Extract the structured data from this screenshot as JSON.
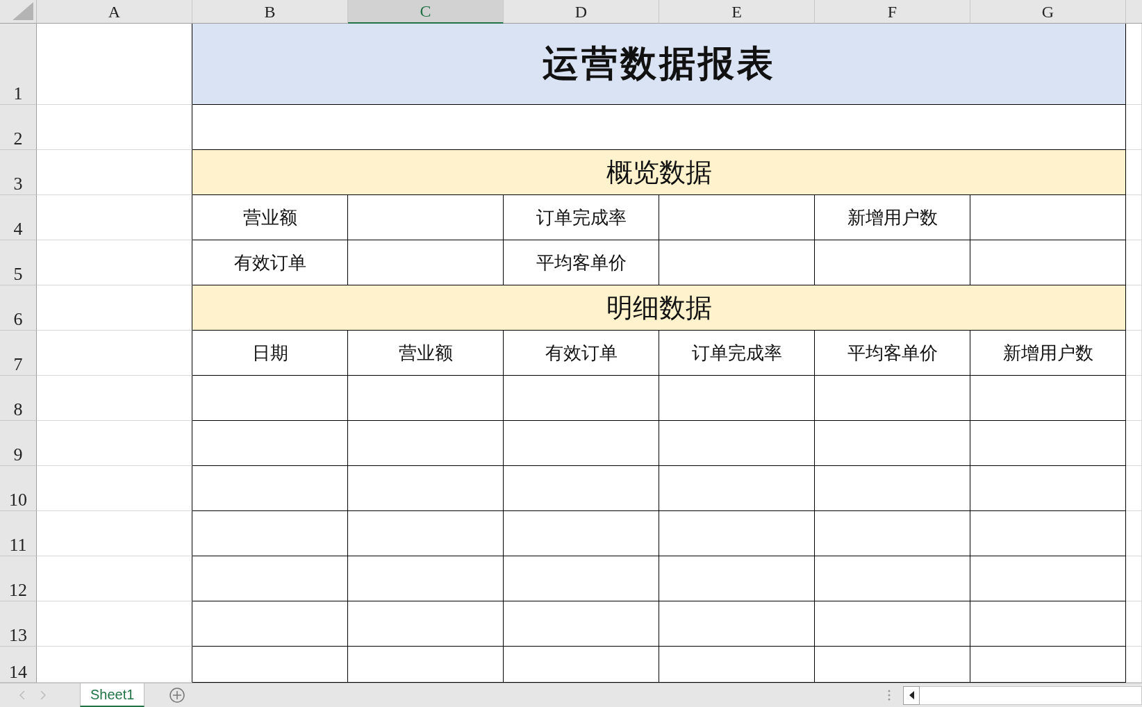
{
  "columns": [
    {
      "label": "A",
      "selected": false
    },
    {
      "label": "B",
      "selected": false
    },
    {
      "label": "C",
      "selected": true
    },
    {
      "label": "D",
      "selected": false
    },
    {
      "label": "E",
      "selected": false
    },
    {
      "label": "F",
      "selected": false
    },
    {
      "label": "G",
      "selected": false
    }
  ],
  "rows": [
    {
      "number": "1",
      "kind": "title",
      "text": "运营数据报表"
    },
    {
      "number": "2",
      "kind": "blank"
    },
    {
      "number": "3",
      "kind": "section",
      "text": "概览数据"
    },
    {
      "number": "4",
      "kind": "cells",
      "cells": [
        {
          "text": "营业额"
        },
        {},
        {
          "text": "订单完成率"
        },
        {},
        {
          "text": "新增用户数"
        },
        {}
      ]
    },
    {
      "number": "5",
      "kind": "cells",
      "cells": [
        {
          "text": "有效订单"
        },
        {},
        {
          "text": "平均客单价"
        },
        {},
        {},
        {}
      ]
    },
    {
      "number": "6",
      "kind": "section",
      "text": "明细数据"
    },
    {
      "number": "7",
      "kind": "cells",
      "cells": [
        {
          "text": "日期"
        },
        {
          "text": "营业额"
        },
        {
          "text": "有效订单"
        },
        {
          "text": "订单完成率"
        },
        {
          "text": "平均客单价"
        },
        {
          "text": "新增用户数"
        }
      ]
    },
    {
      "number": "8",
      "kind": "empty"
    },
    {
      "number": "9",
      "kind": "empty"
    },
    {
      "number": "10",
      "kind": "empty"
    },
    {
      "number": "11",
      "kind": "empty"
    },
    {
      "number": "12",
      "kind": "empty"
    },
    {
      "number": "13",
      "kind": "empty"
    },
    {
      "number": "14",
      "kind": "empty"
    }
  ],
  "sheet_tabs": [
    {
      "label": "Sheet1",
      "selected": true
    }
  ]
}
